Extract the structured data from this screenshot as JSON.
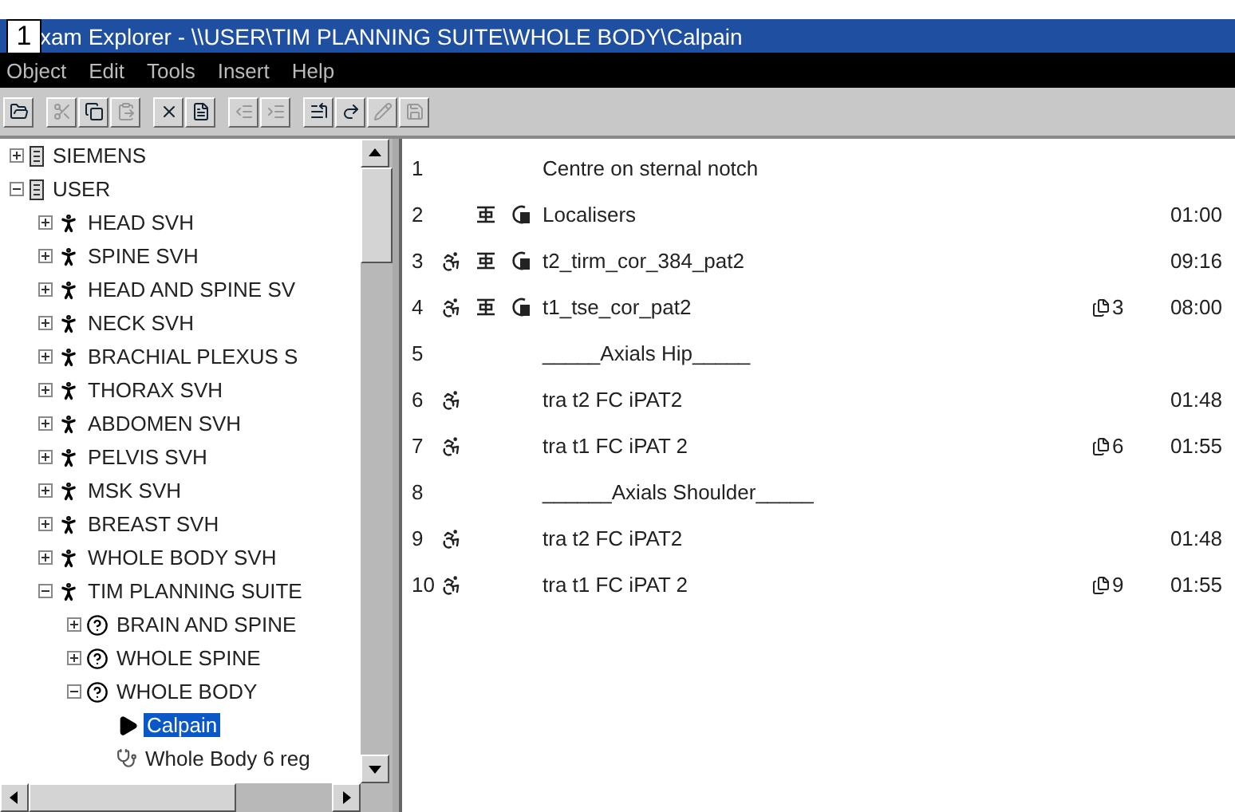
{
  "window": {
    "badge": "1",
    "title": "xam Explorer - \\\\USER\\TIM PLANNING SUITE\\WHOLE BODY\\Calpain"
  },
  "menu": [
    "Object",
    "Edit",
    "Tools",
    "Insert",
    "Help"
  ],
  "toolbar": [
    [
      {
        "kind": "open",
        "disabled": false
      }
    ],
    [
      {
        "kind": "cut",
        "disabled": true
      },
      {
        "kind": "copy",
        "disabled": false
      },
      {
        "kind": "paste",
        "disabled": true
      }
    ],
    [
      {
        "kind": "delete",
        "disabled": false
      },
      {
        "kind": "properties",
        "disabled": false
      }
    ],
    [
      {
        "kind": "outdent",
        "disabled": true
      },
      {
        "kind": "indent",
        "disabled": true
      }
    ],
    [
      {
        "kind": "insert",
        "disabled": false
      },
      {
        "kind": "redo",
        "disabled": false
      },
      {
        "kind": "edit",
        "disabled": true
      },
      {
        "kind": "save",
        "disabled": true
      }
    ]
  ],
  "tree": [
    {
      "label": "SIEMENS",
      "kind": "server",
      "expanded": false,
      "selected": false
    },
    {
      "label": "USER",
      "kind": "server",
      "expanded": true,
      "selected": false,
      "children": [
        {
          "label": "HEAD  SVH",
          "kind": "person",
          "expanded": false,
          "selected": false
        },
        {
          "label": "SPINE SVH",
          "kind": "person",
          "expanded": false,
          "selected": false
        },
        {
          "label": "HEAD AND SPINE  SV",
          "kind": "person",
          "expanded": false,
          "selected": false
        },
        {
          "label": "NECK  SVH",
          "kind": "person",
          "expanded": false,
          "selected": false
        },
        {
          "label": "BRACHIAL PLEXUS  S",
          "kind": "person",
          "expanded": false,
          "selected": false
        },
        {
          "label": "THORAX  SVH",
          "kind": "person",
          "expanded": false,
          "selected": false
        },
        {
          "label": "ABDOMEN SVH",
          "kind": "person",
          "expanded": false,
          "selected": false
        },
        {
          "label": "PELVIS SVH",
          "kind": "person",
          "expanded": false,
          "selected": false
        },
        {
          "label": "MSK  SVH",
          "kind": "person",
          "expanded": false,
          "selected": false
        },
        {
          "label": "BREAST SVH",
          "kind": "person",
          "expanded": false,
          "selected": false
        },
        {
          "label": "WHOLE BODY SVH",
          "kind": "person",
          "expanded": false,
          "selected": false
        },
        {
          "label": "TIM PLANNING SUITE",
          "kind": "person",
          "expanded": true,
          "selected": false,
          "children": [
            {
              "label": "BRAIN AND SPINE",
              "kind": "question",
              "expanded": false,
              "selected": false
            },
            {
              "label": "WHOLE SPINE",
              "kind": "question",
              "expanded": false,
              "selected": false
            },
            {
              "label": "WHOLE BODY",
              "kind": "question",
              "expanded": true,
              "selected": false,
              "children": [
                {
                  "label": "Calpain",
                  "kind": "protocol",
                  "selected": true
                },
                {
                  "label": "Whole Body 6 reg",
                  "kind": "program",
                  "selected": false
                }
              ]
            }
          ]
        }
      ]
    }
  ],
  "steps": [
    {
      "number": "1",
      "patient": false,
      "table": false,
      "coil": false,
      "name": "Centre on sternal notch"
    },
    {
      "number": "2",
      "patient": false,
      "table": true,
      "coil": true,
      "name": "Localisers",
      "time": "01:00"
    },
    {
      "number": "3",
      "patient": true,
      "table": true,
      "coil": true,
      "name": "t2_tirm_cor_384_pat2",
      "time": "09:16"
    },
    {
      "number": "4",
      "patient": true,
      "table": true,
      "coil": true,
      "name": "t1_tse_cor_pat2",
      "copies": "3",
      "time": "08:00"
    },
    {
      "number": "5",
      "patient": false,
      "table": false,
      "coil": false,
      "name": "_____Axials Hip_____"
    },
    {
      "number": "6",
      "patient": true,
      "table": false,
      "coil": false,
      "name": "tra t2 FC iPAT2",
      "time": "01:48"
    },
    {
      "number": "7",
      "patient": true,
      "table": false,
      "coil": false,
      "name": "tra t1  FC iPAT 2",
      "copies": "6",
      "time": "01:55"
    },
    {
      "number": "8",
      "patient": false,
      "table": false,
      "coil": false,
      "name": "______Axials Shoulder_____"
    },
    {
      "number": "9",
      "patient": true,
      "table": false,
      "coil": false,
      "name": "tra t2 FC iPAT2",
      "time": "01:48"
    },
    {
      "number": "10",
      "patient": true,
      "table": false,
      "coil": false,
      "name": "tra t1  FC iPAT 2",
      "copies": "9",
      "time": "01:55"
    }
  ]
}
